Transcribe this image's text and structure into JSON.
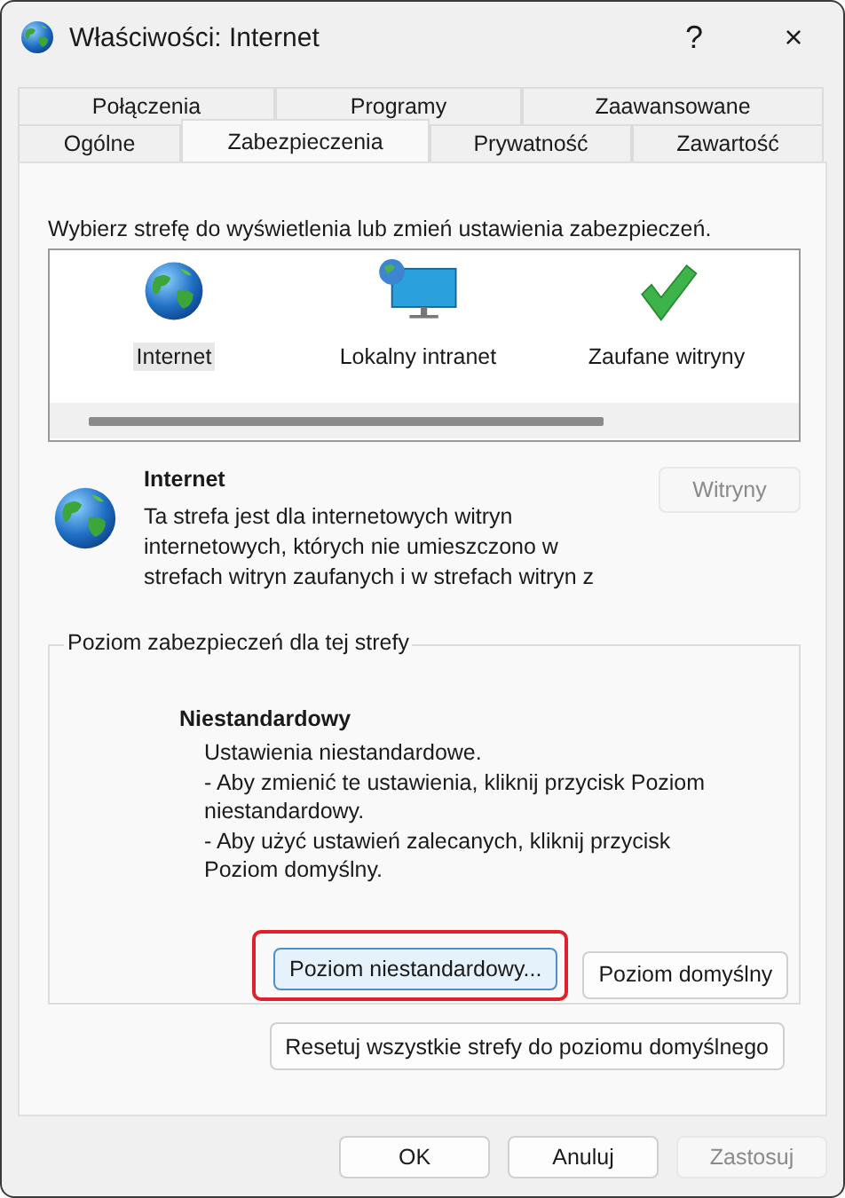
{
  "window": {
    "title": "Właściwości: Internet",
    "help": "?",
    "close": "×"
  },
  "tabs": [
    [
      {
        "label": "Połączenia",
        "selected": false
      },
      {
        "label": "Programy",
        "selected": false
      },
      {
        "label": "Zaawansowane",
        "selected": false
      }
    ],
    [
      {
        "label": "Ogólne",
        "selected": false
      },
      {
        "label": "Zabezpieczenia",
        "selected": true
      },
      {
        "label": "Prywatność",
        "selected": false
      },
      {
        "label": "Zawartość",
        "selected": false
      }
    ]
  ],
  "zone_prompt": "Wybierz strefę do wyświetlenia lub zmień ustawienia zabezpieczeń.",
  "zones": [
    {
      "label": "Internet",
      "kind": "globe",
      "selected": true
    },
    {
      "label": "Lokalny intranet",
      "kind": "monitor",
      "selected": false
    },
    {
      "label": "Zaufane witryny",
      "kind": "check",
      "selected": false
    }
  ],
  "zone_info": {
    "title": "Internet",
    "description": "Ta strefa jest dla internetowych witryn internetowych, których nie umieszczono w strefach witryn zaufanych i w strefach witryn z",
    "sites_button": {
      "label": "Witryny",
      "disabled": true
    }
  },
  "security_level": {
    "legend": "Poziom zabezpieczeń dla tej strefy",
    "level_name": "Niestandardowy",
    "lines": [
      "Ustawienia niestandardowe.",
      "- Aby zmienić te ustawienia, kliknij przycisk Poziom niestandardowy.",
      "- Aby użyć ustawień zalecanych, kliknij przycisk Poziom domyślny."
    ],
    "buttons": [
      {
        "label": "Poziom niestandardowy...",
        "highlighted": true,
        "focused": true
      },
      {
        "label": "Poziom domyślny",
        "highlighted": false,
        "focused": false
      }
    ]
  },
  "reset_button": "Resetuj wszystkie strefy do poziomu domyślnego",
  "footer_buttons": [
    {
      "label": "OK",
      "disabled": false
    },
    {
      "label": "Anuluj",
      "disabled": false
    },
    {
      "label": "Zastosuj",
      "disabled": true
    }
  ]
}
